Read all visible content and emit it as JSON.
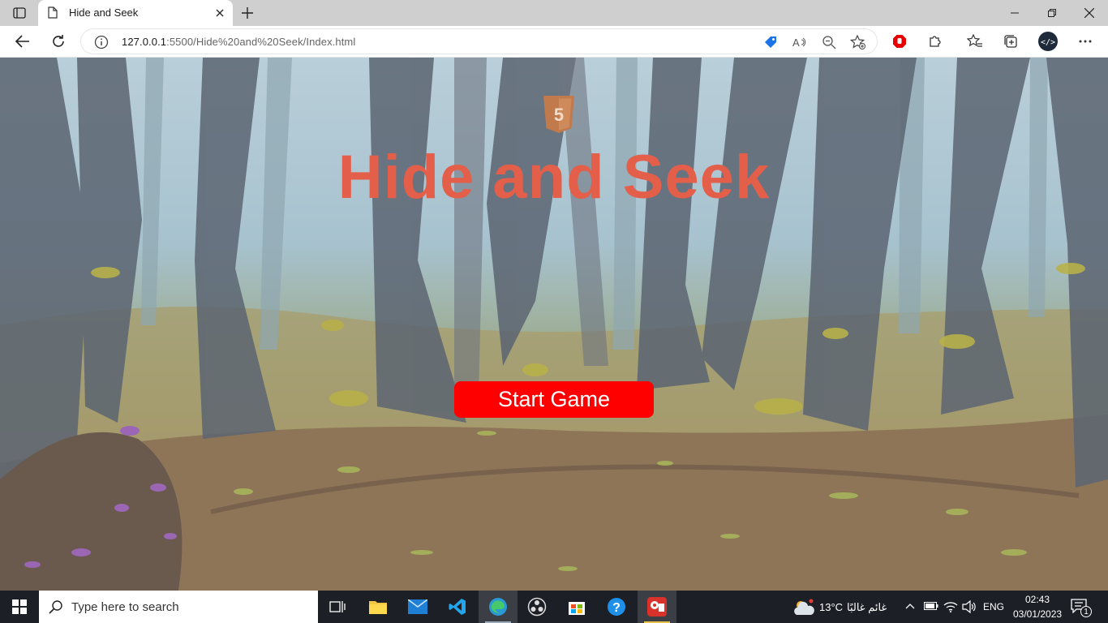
{
  "browser": {
    "tab_title": "Hide and Seek",
    "url_host": "127.0.0.1",
    "url_rest": ":5500/Hide%20and%20Seek/Index.html"
  },
  "page": {
    "title": "Hide and Seek",
    "start_button": "Start Game",
    "badge_digit": "5"
  },
  "taskbar": {
    "search_placeholder": "Type here to search",
    "weather_temp": "13°C",
    "weather_desc": "غائم غالبًا",
    "language": "ENG",
    "time": "02:43",
    "date": "03/01/2023",
    "notification_count": "1"
  },
  "colors": {
    "title": "#e35f4a",
    "start_button": "#ff0000",
    "taskbar": "#1c1f26"
  }
}
